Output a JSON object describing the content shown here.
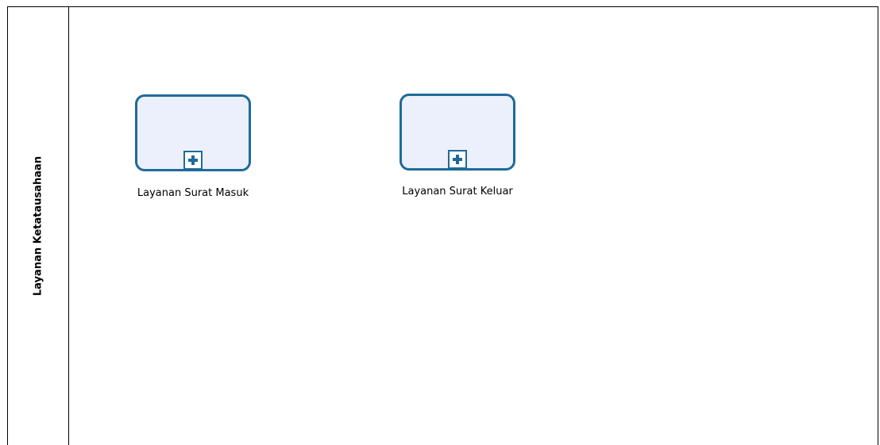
{
  "lane": {
    "title": "Layanan Ketatausahaan"
  },
  "tasks": [
    {
      "label": "Layanan Surat Masuk",
      "marker_icon": "subprocess-plus-icon"
    },
    {
      "label": "Layanan Surat Keluar",
      "marker_icon": "subprocess-plus-icon"
    }
  ],
  "colors": {
    "task_border": "#1f6a9a",
    "task_fill": "#ebf0fc",
    "lane_border": "#000000"
  }
}
